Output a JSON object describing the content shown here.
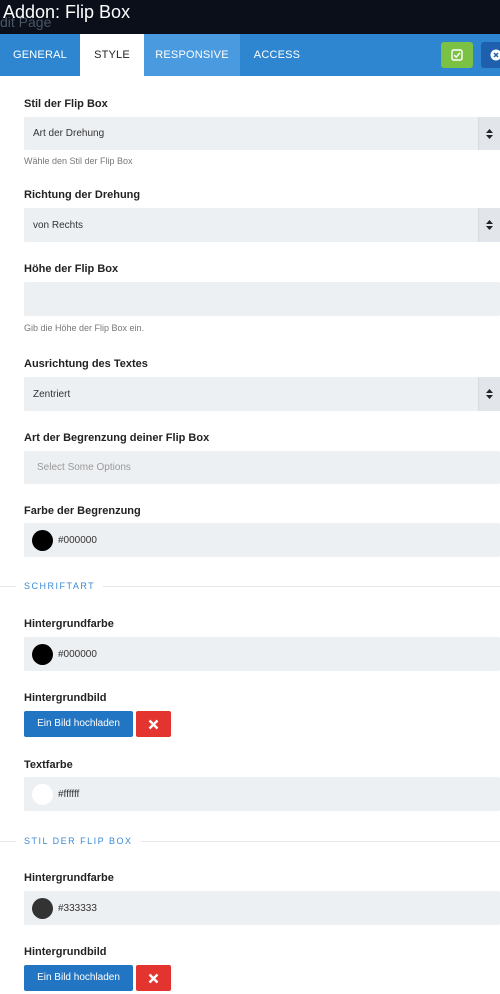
{
  "header": {
    "ghost_text": "dit Page",
    "title": "Addon: Flip Box"
  },
  "tabs": [
    {
      "label": "General"
    },
    {
      "label": "Style"
    },
    {
      "label": "Responsive"
    },
    {
      "label": "Access"
    }
  ],
  "fields": {
    "flipbox_style": {
      "label": "Stil der Flip Box",
      "value": "Art der Drehung",
      "help": "Wähle den Stil der Flip Box"
    },
    "rotate_direction": {
      "label": "Richtung der Drehung",
      "value": "von Rechts"
    },
    "flipbox_height": {
      "label": "Höhe der Flip Box",
      "value": "",
      "help": "Gib die Höhe der Flip Box ein."
    },
    "text_align": {
      "label": "Ausrichtung des Textes",
      "value": "Zentriert"
    },
    "border_type": {
      "label": "Art der Begrenzung deiner Flip Box",
      "placeholder": "Select Some Options"
    },
    "border_color": {
      "label": "Farbe der Begrenzung",
      "value": "#000000",
      "swatch": "#000000"
    }
  },
  "section_front": {
    "title": "SCHRIFTART",
    "bg_color": {
      "label": "Hintergrundfarbe",
      "value": "#000000",
      "swatch": "#000000"
    },
    "bg_image": {
      "label": "Hintergrundbild",
      "upload_label": "Ein Bild hochladen"
    },
    "text_color": {
      "label": "Textfarbe",
      "value": "#ffffff",
      "swatch": "#ffffff"
    }
  },
  "section_back": {
    "title": "STIL DER FLIP BOX",
    "bg_color": {
      "label": "Hintergrundfarbe",
      "value": "#333333",
      "swatch": "#333333"
    },
    "bg_image": {
      "label": "Hintergrundbild",
      "upload_label": "Ein Bild hochladen"
    }
  },
  "colors": {
    "tab_bar": "#2e86d1",
    "save_button": "#7bc143",
    "upload_button": "#2275c2",
    "remove_button": "#e3342f",
    "section_title": "#3a8ad6"
  },
  "icons": {
    "save": "check-square-icon",
    "close": "close-icon",
    "remove": "times-icon",
    "select": "sort-arrows-icon"
  }
}
